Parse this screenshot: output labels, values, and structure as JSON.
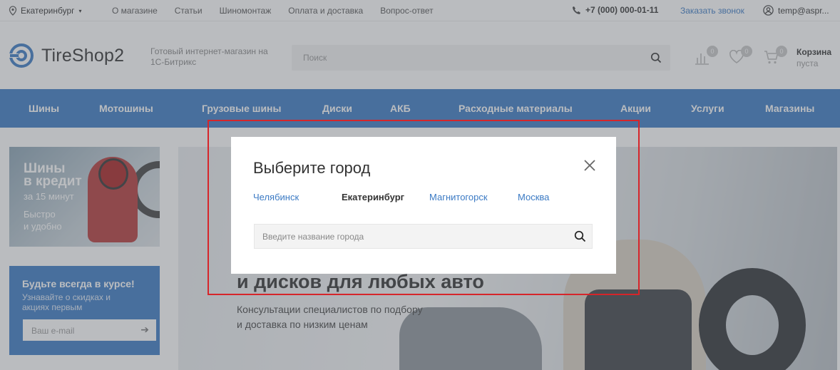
{
  "topbar": {
    "city": "Екатеринбург",
    "menu": [
      "О магазине",
      "Статьи",
      "Шиномонтаж",
      "Оплата и доставка",
      "Вопрос-ответ"
    ],
    "phone": "+7 (000) 000-01-11",
    "callback": "Заказать звонок",
    "user": "temp@aspr..."
  },
  "header": {
    "logo": "TireShop2",
    "tagline": "Готовый интернет-магазин на 1С-Битрикс",
    "search_placeholder": "Поиск",
    "compare_count": "0",
    "favorites_count": "0",
    "cart_count": "0",
    "cart_title": "Корзина",
    "cart_status": "пуста"
  },
  "nav": {
    "items": [
      "Шины",
      "Мотошины",
      "Грузовые шины",
      "Диски",
      "АКБ",
      "Расходные материалы",
      "Акции",
      "Услуги",
      "Магазины"
    ]
  },
  "promo_credit": {
    "heading_line1": "Шины",
    "heading_line2": "в кредит",
    "subtitle": "за 15 минут",
    "text_line1": "Быстро",
    "text_line2": "и удобно"
  },
  "promo_subscribe": {
    "heading": "Будьте всегда в курсе!",
    "text_line1": "Узнавайте о скидках и",
    "text_line2": "акциях первым",
    "email_placeholder": "Ваш e-mail"
  },
  "banner": {
    "headline": "и дисков для любых авто",
    "sub_line1": "Консультации специалистов по подбору",
    "sub_line2": "и доставка по низким ценам"
  },
  "city_modal": {
    "title": "Выберите город",
    "cities": [
      {
        "label": "Челябинск",
        "active": false
      },
      {
        "label": "Екатеринбург",
        "active": true
      },
      {
        "label": "Магнитогорск",
        "active": false
      },
      {
        "label": "Москва",
        "active": false
      }
    ],
    "input_placeholder": "Введите название города"
  },
  "colors": {
    "brand_blue": "#3b7ac4",
    "highlight_frame": "#d6252a"
  }
}
